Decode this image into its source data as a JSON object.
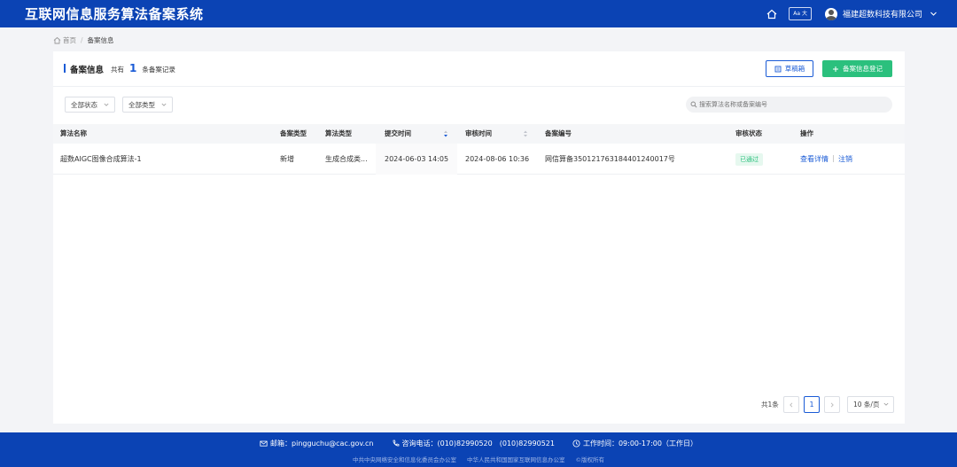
{
  "header": {
    "title": "互联网信息服务算法备案系统",
    "font_toggle": "Aa 大",
    "company": "福建超数科技有限公司"
  },
  "breadcrumb": {
    "home": "首页",
    "separator": "/",
    "current": "备案信息"
  },
  "card": {
    "title": "备案信息",
    "count_prefix": "共有",
    "count": "1",
    "count_suffix": "条备案记录",
    "draft_button": "草稿箱",
    "add_button": "备案信息登记"
  },
  "filters": {
    "status": "全部状态",
    "type": "全部类型",
    "search_placeholder": "搜索算法名称或备案编号"
  },
  "table": {
    "columns": [
      "算法名称",
      "备案类型",
      "算法类型",
      "提交时间",
      "审核时间",
      "备案编号",
      "审核状态",
      "操作"
    ],
    "rows": [
      {
        "name": "超数AIGC图像合成算法-1",
        "filing_type": "新增",
        "algo_type": "生成合成类...",
        "submit_time": "2024-06-03 14:05",
        "review_time": "2024-08-06 10:36",
        "filing_no": "网信算备350121763184401240017号",
        "status": "已通过",
        "action_detail": "查看详情",
        "action_cancel": "注销"
      }
    ]
  },
  "pagination": {
    "total": "共1条",
    "current_page": "1",
    "page_size": "10 条/页"
  },
  "footer": {
    "email": "邮箱：pingguchu@cac.gov.cn",
    "phone": "咨询电话：(010)82990520　(010)82990521",
    "hours": "工作时间：09:00-17:00（工作日）",
    "org1": "中共中央网络安全和信息化委员会办公室",
    "org2": "中华人民共和国国家互联网信息办公室",
    "copyright": "©版权所有"
  },
  "colors": {
    "brand_blue": "#0b43b4",
    "accent_blue": "#1a5bd6",
    "success_green": "#2bc07d"
  }
}
